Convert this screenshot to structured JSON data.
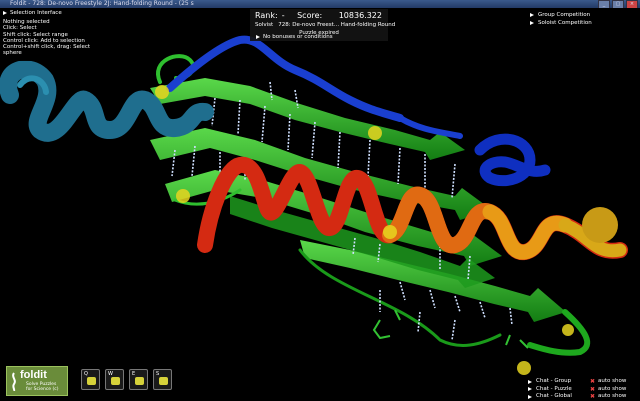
{
  "window": {
    "title": "Foldit - 728: De-novo Freestyle 2J: Hand-folding Round - (25 s"
  },
  "selection_panel": {
    "header": "Selection Interface",
    "lines": [
      "Nothing selected",
      "Click: Select",
      "Shift click: Select range",
      "Control click: Add to selection",
      "Control+shift click, drag: Select",
      "sphere"
    ]
  },
  "score_panel": {
    "rank_label": "Rank:",
    "rank_value": "-",
    "score_label": "Score:",
    "score_value": "10836.322",
    "role": "Solvist",
    "puzzle": "728: De-novo Freest... Hand-folding Round",
    "status": "Puzzle expired",
    "bonus": "No bonuses or conditions"
  },
  "competition": {
    "group": "Group Competition",
    "solo": "Soloist Competition"
  },
  "chat": [
    {
      "name": "Chat - Group",
      "auto": "auto show"
    },
    {
      "name": "Chat - Puzzle",
      "auto": "auto show"
    },
    {
      "name": "Chat - Global",
      "auto": "auto show"
    }
  ],
  "logo": {
    "brand": "foldit",
    "tagline1": "Solve Puzzles",
    "tagline2": "for Science",
    "badge": "(c)"
  },
  "tools": [
    {
      "key": "Q"
    },
    {
      "key": "W"
    },
    {
      "key": "E"
    },
    {
      "key": "S"
    }
  ],
  "colors": {
    "sheet": "#22a822",
    "helix_red": "#d42a12",
    "helix_orange": "#e06a12",
    "helix_blue": "#1a3fd0",
    "helix_teal": "#1f6e8e",
    "hbond": "#cfe0ff",
    "sidechain": "#e6d520"
  }
}
